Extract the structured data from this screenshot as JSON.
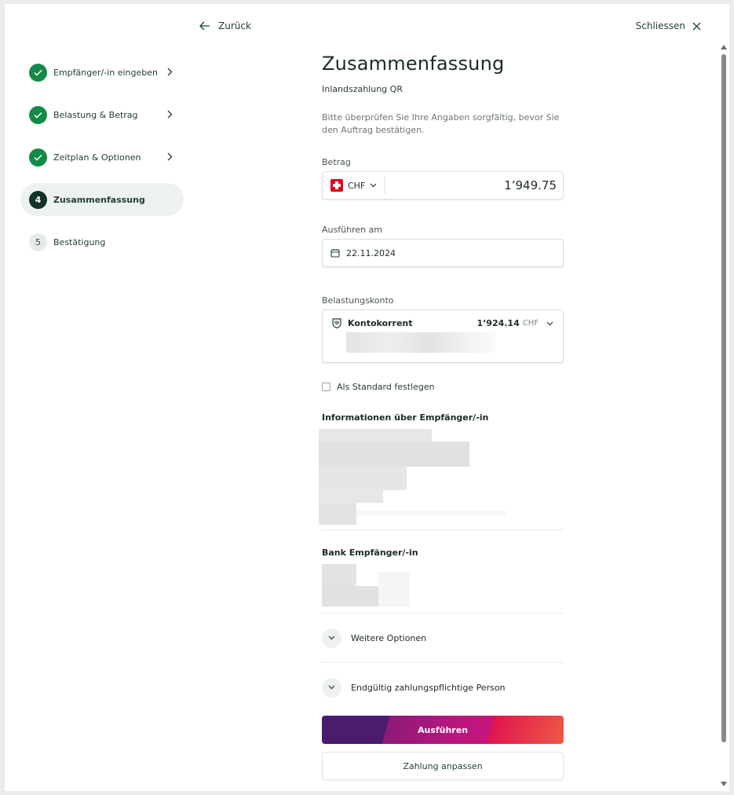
{
  "topbar": {
    "back_label": "Zurück",
    "close_label": "Schliessen"
  },
  "steps": [
    {
      "label": "Empfänger/-in eingeben",
      "state": "done",
      "number": "1"
    },
    {
      "label": "Belastung & Betrag",
      "state": "done",
      "number": "2"
    },
    {
      "label": "Zeitplan & Optionen",
      "state": "done",
      "number": "3"
    },
    {
      "label": "Zusammenfassung",
      "state": "current",
      "number": "4"
    },
    {
      "label": "Bestätigung",
      "state": "pending",
      "number": "5"
    }
  ],
  "main": {
    "title": "Zusammenfassung",
    "subtitle": "Inlandszahlung QR",
    "hint": "Bitte überprüfen Sie Ihre Angaben sorgfältig, bevor Sie den Auftrag bestätigen.",
    "amount": {
      "label": "Betrag",
      "currency": "CHF",
      "value": "1’949.75"
    },
    "execution": {
      "label": "Ausführen am",
      "date": "22.11.2024"
    },
    "account": {
      "label": "Belastungskonto",
      "name": "Kontokorrent",
      "balance": "1’924.14",
      "currency": "CHF"
    },
    "default_checkbox": {
      "label": "Als Standard festlegen",
      "checked": false
    },
    "recipient_info": {
      "title": "Informationen über Empfänger/-in"
    },
    "recipient_bank": {
      "title": "Bank Empfänger/-in"
    },
    "expanders": [
      {
        "label": "Weitere Optionen"
      },
      {
        "label": "Endgültig zahlungspflichtige Person"
      }
    ],
    "buttons": {
      "execute": "Ausführen",
      "adjust": "Zahlung anpassen"
    }
  },
  "colors": {
    "done_green": "#138a47",
    "current_dark": "#13342a",
    "primary_purple": "#4b1b6e",
    "primary_magenta": "#c6157c",
    "primary_red": "#ee5846"
  },
  "icons": {
    "back": "arrow-left-icon",
    "close": "close-icon",
    "step_done": "checkmark-icon",
    "step_chevron": "chevron-right-icon",
    "currency_dropdown": "chevron-down-icon",
    "calendar": "calendar-icon",
    "account": "bank-shield-icon",
    "expander": "chevron-down-icon"
  }
}
